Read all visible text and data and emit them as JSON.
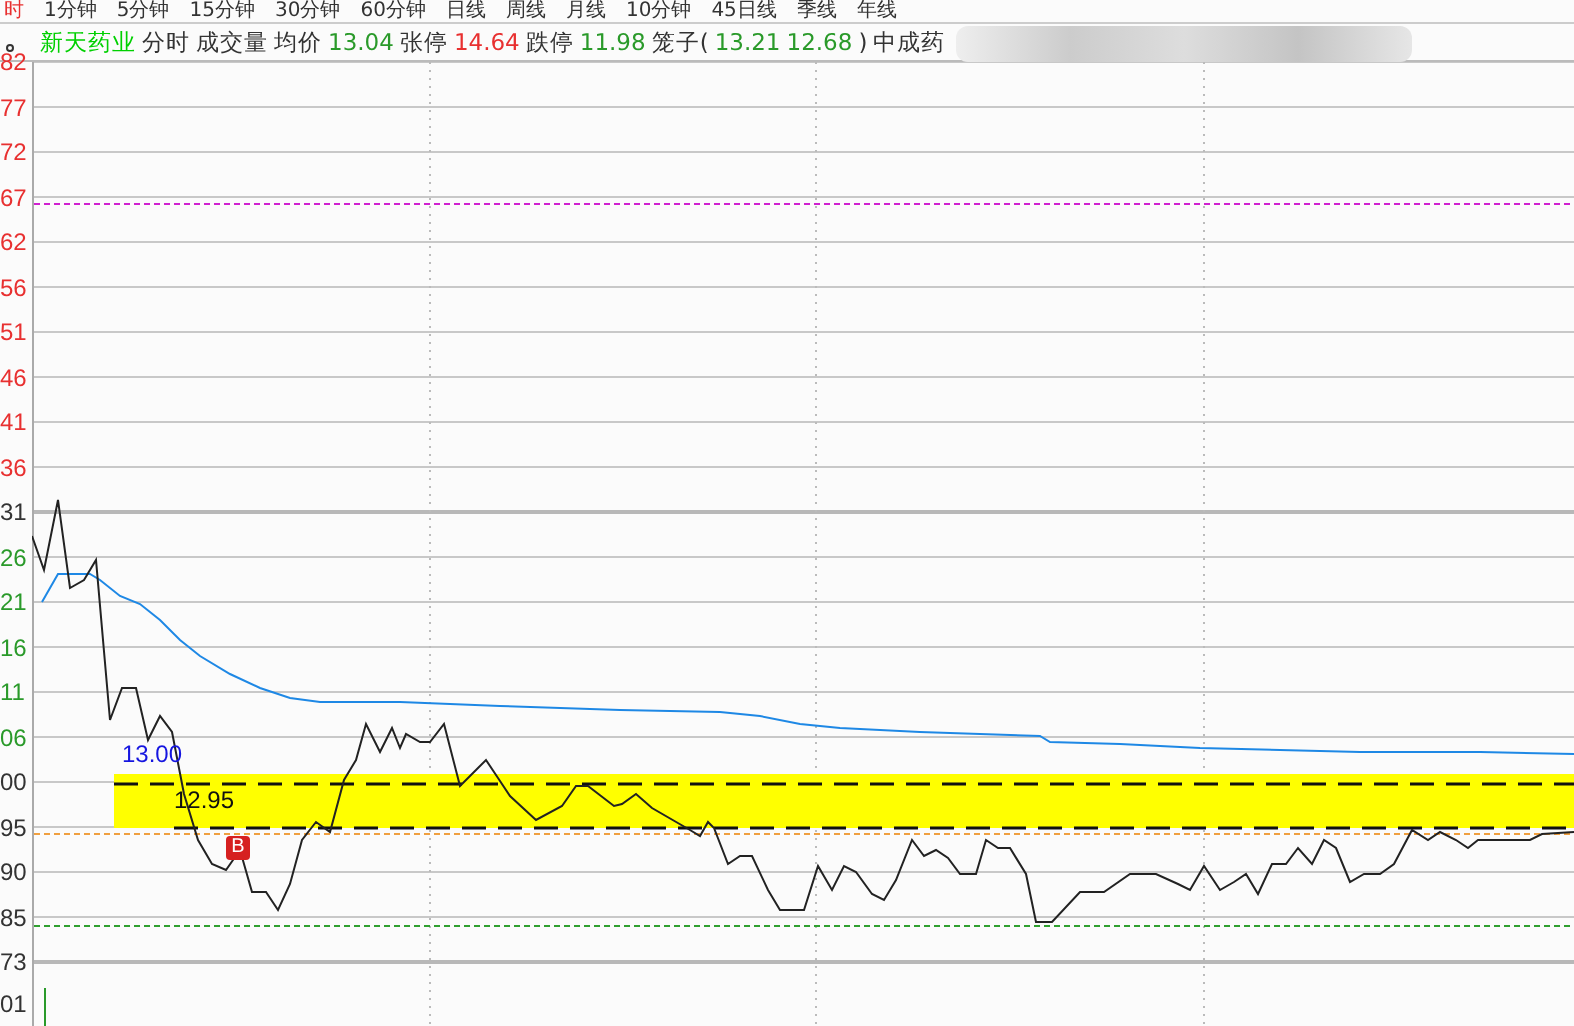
{
  "menu": [
    {
      "label": "时",
      "selected": true
    },
    {
      "label": "1分钟",
      "selected": false
    },
    {
      "label": "5分钟",
      "selected": false
    },
    {
      "label": "15分钟",
      "selected": false
    },
    {
      "label": "30分钟",
      "selected": false
    },
    {
      "label": "60分钟",
      "selected": false
    },
    {
      "label": "日线",
      "selected": false
    },
    {
      "label": "周线",
      "selected": false
    },
    {
      "label": "月线",
      "selected": false
    },
    {
      "label": "10分钟",
      "selected": false
    },
    {
      "label": "45日线",
      "selected": false
    },
    {
      "label": "季线",
      "selected": false
    },
    {
      "label": "年线",
      "selected": false
    }
  ],
  "header": [
    {
      "text": "新天药业",
      "kind": "name"
    },
    {
      "text": "分时",
      "kind": "plain"
    },
    {
      "text": "成交量",
      "kind": "plain"
    },
    {
      "text": "均价",
      "kind": "plain"
    },
    {
      "text": "13.04",
      "kind": "down"
    },
    {
      "text": "张停",
      "kind": "plain"
    },
    {
      "text": "14.64",
      "kind": "up"
    },
    {
      "text": "跌停",
      "kind": "plain"
    },
    {
      "text": "11.98",
      "kind": "down"
    },
    {
      "text": "笼子(",
      "kind": "plain"
    },
    {
      "text": "13.21",
      "kind": "down"
    },
    {
      "text": "12.68",
      "kind": "down"
    },
    {
      "text": ")",
      "kind": "plain"
    },
    {
      "text": "中成药",
      "kind": "plain"
    }
  ],
  "axis_labels": [
    {
      "text": "82",
      "color": "#e83030"
    },
    {
      "text": "77",
      "color": "#e83030"
    },
    {
      "text": "72",
      "color": "#e83030"
    },
    {
      "text": "67",
      "color": "#e83030"
    },
    {
      "text": "62",
      "color": "#e83030"
    },
    {
      "text": "56",
      "color": "#e83030"
    },
    {
      "text": "51",
      "color": "#e83030"
    },
    {
      "text": "46",
      "color": "#e83030"
    },
    {
      "text": "41",
      "color": "#e83030"
    },
    {
      "text": "36",
      "color": "#e83030"
    },
    {
      "text": "31",
      "color": "#333333"
    },
    {
      "text": "26",
      "color": "#2a9a2a"
    },
    {
      "text": "21",
      "color": "#2a9a2a"
    },
    {
      "text": "16",
      "color": "#2a9a2a"
    },
    {
      "text": "11",
      "color": "#2a9a2a"
    },
    {
      "text": "06",
      "color": "#2a9a2a"
    },
    {
      "text": "00",
      "color": "#333333"
    },
    {
      "text": "95",
      "color": "#333333"
    },
    {
      "text": "90",
      "color": "#333333"
    },
    {
      "text": "85",
      "color": "#333333"
    },
    {
      "text": "73",
      "color": "#333333"
    },
    {
      "text": "01",
      "color": "#333333"
    }
  ],
  "chart": {
    "upper_label": "13.00",
    "lower_label": "12.95",
    "marker": "B"
  }
}
